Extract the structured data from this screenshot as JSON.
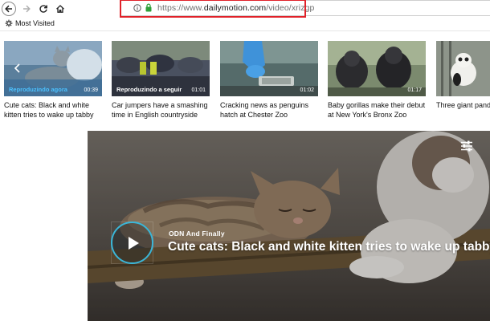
{
  "browser": {
    "url_prefix": "https://www.",
    "url_domain": "dailymotion.com",
    "url_path": "/video/xrizgp",
    "bookmarks": [
      {
        "label": "Most Visited",
        "icon": "gear-icon"
      }
    ]
  },
  "colors": {
    "highlight": "#e0222a",
    "accent": "#4cc2ff",
    "play_ring": "#3ab6d8"
  },
  "strip": {
    "cards": [
      {
        "overlay": "Reproduzindo agora",
        "duration": "00:39",
        "title": "Cute cats: Black and white kitten tries to wake up tabby",
        "active": true
      },
      {
        "overlay": "Reproduzindo a seguir",
        "duration": "01:01",
        "title": "Car jumpers have a smashing time in English countryside",
        "active": false
      },
      {
        "overlay": "",
        "duration": "01:02",
        "title": "Cracking news as penguins hatch at Chester Zoo",
        "active": false
      },
      {
        "overlay": "",
        "duration": "01:17",
        "title": "Baby gorillas make their debut at New York's Bronx Zoo",
        "active": false
      },
      {
        "overlay": "",
        "duration": "",
        "title": "Three giant panda... disease",
        "active": false
      }
    ]
  },
  "player": {
    "channel": "ODN And Finally",
    "title": "Cute cats: Black and white kitten tries to wake up tabby"
  }
}
